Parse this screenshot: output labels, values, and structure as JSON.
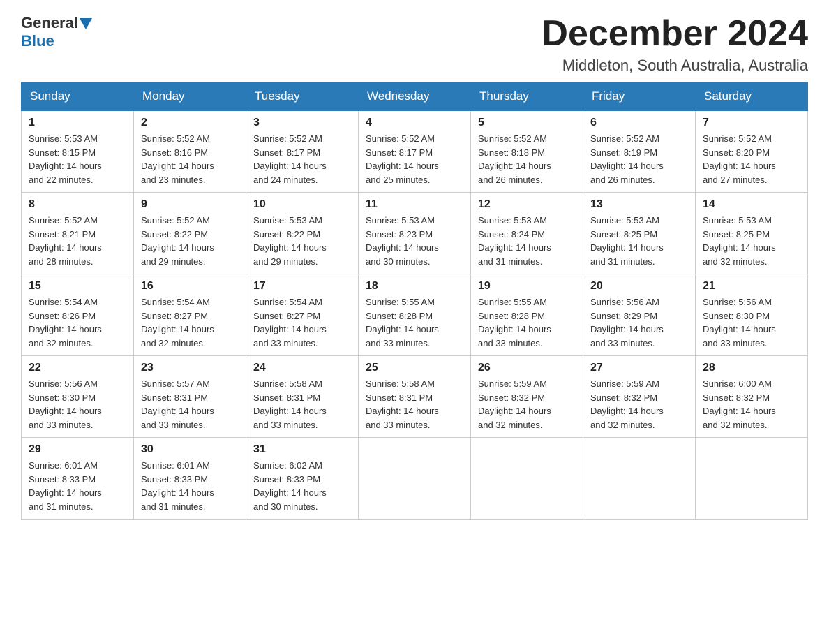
{
  "header": {
    "logo_general": "General",
    "logo_blue": "Blue",
    "month_title": "December 2024",
    "location": "Middleton, South Australia, Australia"
  },
  "weekdays": [
    "Sunday",
    "Monday",
    "Tuesday",
    "Wednesday",
    "Thursday",
    "Friday",
    "Saturday"
  ],
  "weeks": [
    [
      {
        "day": "1",
        "sunrise": "Sunrise: 5:53 AM",
        "sunset": "Sunset: 8:15 PM",
        "daylight": "Daylight: 14 hours",
        "daylight2": "and 22 minutes."
      },
      {
        "day": "2",
        "sunrise": "Sunrise: 5:52 AM",
        "sunset": "Sunset: 8:16 PM",
        "daylight": "Daylight: 14 hours",
        "daylight2": "and 23 minutes."
      },
      {
        "day": "3",
        "sunrise": "Sunrise: 5:52 AM",
        "sunset": "Sunset: 8:17 PM",
        "daylight": "Daylight: 14 hours",
        "daylight2": "and 24 minutes."
      },
      {
        "day": "4",
        "sunrise": "Sunrise: 5:52 AM",
        "sunset": "Sunset: 8:17 PM",
        "daylight": "Daylight: 14 hours",
        "daylight2": "and 25 minutes."
      },
      {
        "day": "5",
        "sunrise": "Sunrise: 5:52 AM",
        "sunset": "Sunset: 8:18 PM",
        "daylight": "Daylight: 14 hours",
        "daylight2": "and 26 minutes."
      },
      {
        "day": "6",
        "sunrise": "Sunrise: 5:52 AM",
        "sunset": "Sunset: 8:19 PM",
        "daylight": "Daylight: 14 hours",
        "daylight2": "and 26 minutes."
      },
      {
        "day": "7",
        "sunrise": "Sunrise: 5:52 AM",
        "sunset": "Sunset: 8:20 PM",
        "daylight": "Daylight: 14 hours",
        "daylight2": "and 27 minutes."
      }
    ],
    [
      {
        "day": "8",
        "sunrise": "Sunrise: 5:52 AM",
        "sunset": "Sunset: 8:21 PM",
        "daylight": "Daylight: 14 hours",
        "daylight2": "and 28 minutes."
      },
      {
        "day": "9",
        "sunrise": "Sunrise: 5:52 AM",
        "sunset": "Sunset: 8:22 PM",
        "daylight": "Daylight: 14 hours",
        "daylight2": "and 29 minutes."
      },
      {
        "day": "10",
        "sunrise": "Sunrise: 5:53 AM",
        "sunset": "Sunset: 8:22 PM",
        "daylight": "Daylight: 14 hours",
        "daylight2": "and 29 minutes."
      },
      {
        "day": "11",
        "sunrise": "Sunrise: 5:53 AM",
        "sunset": "Sunset: 8:23 PM",
        "daylight": "Daylight: 14 hours",
        "daylight2": "and 30 minutes."
      },
      {
        "day": "12",
        "sunrise": "Sunrise: 5:53 AM",
        "sunset": "Sunset: 8:24 PM",
        "daylight": "Daylight: 14 hours",
        "daylight2": "and 31 minutes."
      },
      {
        "day": "13",
        "sunrise": "Sunrise: 5:53 AM",
        "sunset": "Sunset: 8:25 PM",
        "daylight": "Daylight: 14 hours",
        "daylight2": "and 31 minutes."
      },
      {
        "day": "14",
        "sunrise": "Sunrise: 5:53 AM",
        "sunset": "Sunset: 8:25 PM",
        "daylight": "Daylight: 14 hours",
        "daylight2": "and 32 minutes."
      }
    ],
    [
      {
        "day": "15",
        "sunrise": "Sunrise: 5:54 AM",
        "sunset": "Sunset: 8:26 PM",
        "daylight": "Daylight: 14 hours",
        "daylight2": "and 32 minutes."
      },
      {
        "day": "16",
        "sunrise": "Sunrise: 5:54 AM",
        "sunset": "Sunset: 8:27 PM",
        "daylight": "Daylight: 14 hours",
        "daylight2": "and 32 minutes."
      },
      {
        "day": "17",
        "sunrise": "Sunrise: 5:54 AM",
        "sunset": "Sunset: 8:27 PM",
        "daylight": "Daylight: 14 hours",
        "daylight2": "and 33 minutes."
      },
      {
        "day": "18",
        "sunrise": "Sunrise: 5:55 AM",
        "sunset": "Sunset: 8:28 PM",
        "daylight": "Daylight: 14 hours",
        "daylight2": "and 33 minutes."
      },
      {
        "day": "19",
        "sunrise": "Sunrise: 5:55 AM",
        "sunset": "Sunset: 8:28 PM",
        "daylight": "Daylight: 14 hours",
        "daylight2": "and 33 minutes."
      },
      {
        "day": "20",
        "sunrise": "Sunrise: 5:56 AM",
        "sunset": "Sunset: 8:29 PM",
        "daylight": "Daylight: 14 hours",
        "daylight2": "and 33 minutes."
      },
      {
        "day": "21",
        "sunrise": "Sunrise: 5:56 AM",
        "sunset": "Sunset: 8:30 PM",
        "daylight": "Daylight: 14 hours",
        "daylight2": "and 33 minutes."
      }
    ],
    [
      {
        "day": "22",
        "sunrise": "Sunrise: 5:56 AM",
        "sunset": "Sunset: 8:30 PM",
        "daylight": "Daylight: 14 hours",
        "daylight2": "and 33 minutes."
      },
      {
        "day": "23",
        "sunrise": "Sunrise: 5:57 AM",
        "sunset": "Sunset: 8:31 PM",
        "daylight": "Daylight: 14 hours",
        "daylight2": "and 33 minutes."
      },
      {
        "day": "24",
        "sunrise": "Sunrise: 5:58 AM",
        "sunset": "Sunset: 8:31 PM",
        "daylight": "Daylight: 14 hours",
        "daylight2": "and 33 minutes."
      },
      {
        "day": "25",
        "sunrise": "Sunrise: 5:58 AM",
        "sunset": "Sunset: 8:31 PM",
        "daylight": "Daylight: 14 hours",
        "daylight2": "and 33 minutes."
      },
      {
        "day": "26",
        "sunrise": "Sunrise: 5:59 AM",
        "sunset": "Sunset: 8:32 PM",
        "daylight": "Daylight: 14 hours",
        "daylight2": "and 32 minutes."
      },
      {
        "day": "27",
        "sunrise": "Sunrise: 5:59 AM",
        "sunset": "Sunset: 8:32 PM",
        "daylight": "Daylight: 14 hours",
        "daylight2": "and 32 minutes."
      },
      {
        "day": "28",
        "sunrise": "Sunrise: 6:00 AM",
        "sunset": "Sunset: 8:32 PM",
        "daylight": "Daylight: 14 hours",
        "daylight2": "and 32 minutes."
      }
    ],
    [
      {
        "day": "29",
        "sunrise": "Sunrise: 6:01 AM",
        "sunset": "Sunset: 8:33 PM",
        "daylight": "Daylight: 14 hours",
        "daylight2": "and 31 minutes."
      },
      {
        "day": "30",
        "sunrise": "Sunrise: 6:01 AM",
        "sunset": "Sunset: 8:33 PM",
        "daylight": "Daylight: 14 hours",
        "daylight2": "and 31 minutes."
      },
      {
        "day": "31",
        "sunrise": "Sunrise: 6:02 AM",
        "sunset": "Sunset: 8:33 PM",
        "daylight": "Daylight: 14 hours",
        "daylight2": "and 30 minutes."
      },
      null,
      null,
      null,
      null
    ]
  ]
}
